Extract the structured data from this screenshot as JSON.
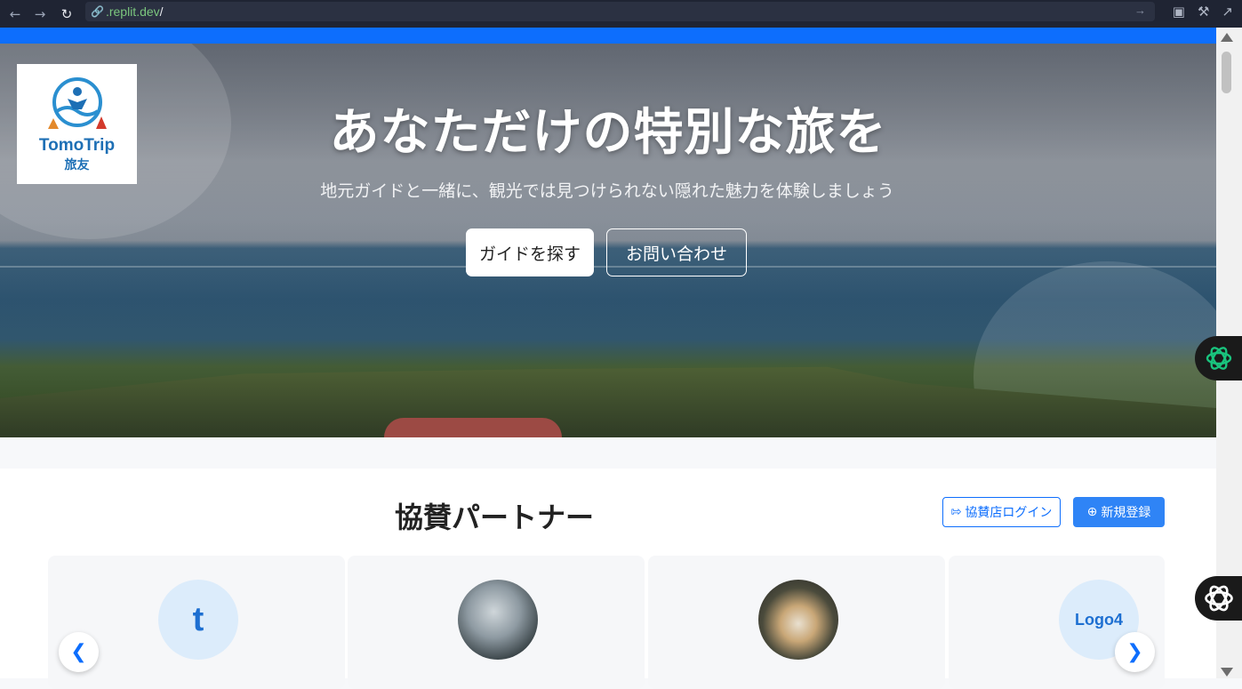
{
  "browser": {
    "url_domain": ".replit.dev",
    "url_path": "/"
  },
  "brand": {
    "name": "TomoTrip",
    "name_jp": "旅友"
  },
  "hero": {
    "title": "あなただけの特別な旅を",
    "subtitle": "地元ガイドと一緒に、観光では見つけられない隠れた魅力を体験しましょう",
    "primary_button": "ガイドを探す",
    "secondary_button": "お問い合わせ"
  },
  "partners": {
    "title": "協賛パートナー",
    "login_button": "協賛店ログイン",
    "register_button": "新規登録",
    "cards": [
      {
        "avatar_type": "letter",
        "avatar_text": "t"
      },
      {
        "avatar_type": "photo"
      },
      {
        "avatar_type": "photo"
      },
      {
        "avatar_type": "text",
        "avatar_text": "Logo4"
      }
    ]
  },
  "colors": {
    "accent": "#0d6efd",
    "chrome_bg": "#1f2433",
    "url_green": "#7bc67e"
  },
  "icons": [
    "back-arrow-icon",
    "forward-arrow-icon",
    "reload-icon",
    "link-icon",
    "monitor-icon",
    "wrench-icon",
    "external-link-icon",
    "login-icon",
    "plus-circle-icon",
    "chevron-left-icon",
    "chevron-right-icon",
    "openai-icon"
  ]
}
